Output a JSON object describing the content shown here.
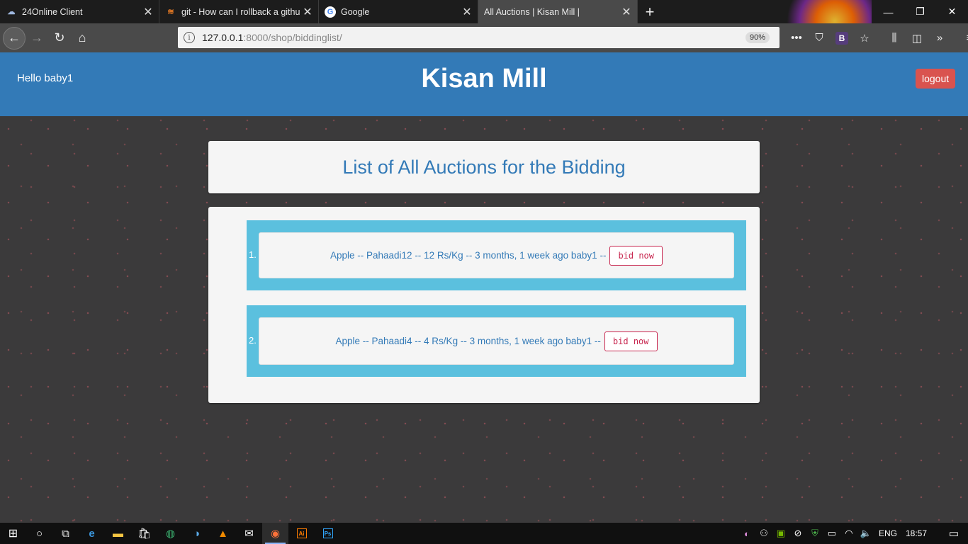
{
  "browser": {
    "tabs": [
      {
        "title": "24Online Client",
        "icon": "cloud-icon",
        "active": false
      },
      {
        "title": "git - How can I rollback a githu",
        "icon": "stackoverflow-icon",
        "active": false
      },
      {
        "title": "Google",
        "icon": "google-icon",
        "active": false
      },
      {
        "title": "All Auctions | Kisan Mill |",
        "icon": "",
        "active": true
      }
    ],
    "new_tab": "+",
    "url_host": "127.0.0.1",
    "url_rest": ":8000/shop/biddinglist/",
    "zoom": "90%"
  },
  "header": {
    "greeting": "Hello baby1",
    "brand": "Kisan Mill",
    "logout_label": "logout",
    "color": "#337ab7"
  },
  "main": {
    "title": "List of All Auctions for the Bidding",
    "auctions": [
      {
        "number": "1.",
        "text": "Apple -- Pahaadi12 -- 12 Rs/Kg -- 3 months, 1 week ago baby1 --",
        "button": "bid now"
      },
      {
        "number": "2.",
        "text": "Apple -- Pahaadi4 -- 4 Rs/Kg -- 3 months, 1 week ago baby1 --",
        "button": "bid now"
      }
    ]
  },
  "taskbar": {
    "language": "ENG",
    "time": "18:57"
  }
}
